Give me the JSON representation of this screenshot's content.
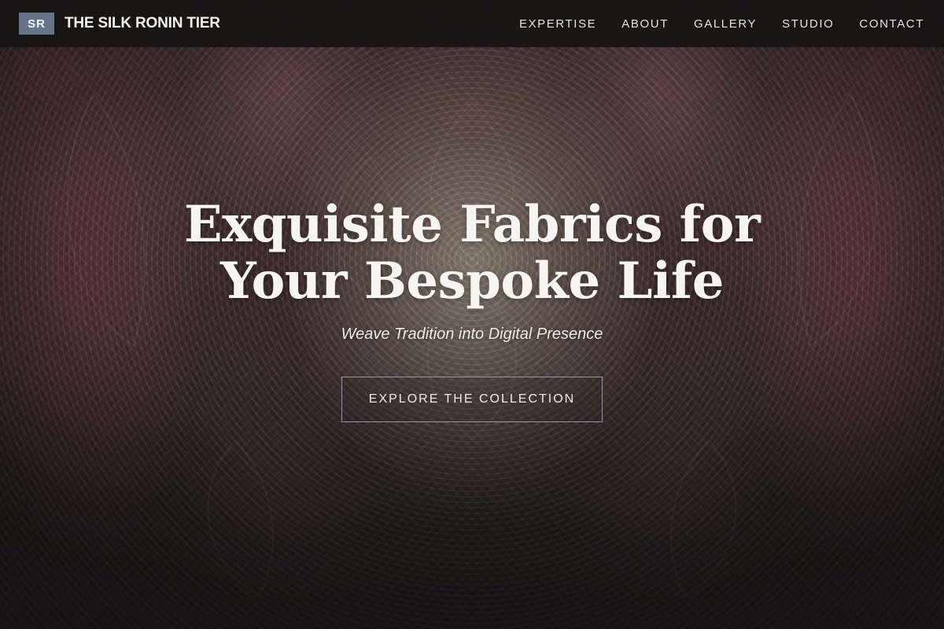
{
  "brand": {
    "logo_initials": "SR",
    "name": "THE SILK RONIN TIER"
  },
  "nav": {
    "items": [
      {
        "label": "EXPERTISE"
      },
      {
        "label": "ABOUT"
      },
      {
        "label": "GALLERY"
      },
      {
        "label": "STUDIO"
      },
      {
        "label": "CONTACT"
      }
    ]
  },
  "hero": {
    "title_line1": "Exquisite Fabrics for",
    "title_line2": "Your Bespoke Life",
    "subtitle": "Weave Tradition into Digital Presence",
    "cta_label": "EXPLORE THE COLLECTION",
    "background_image": "paisley-damask-textile"
  },
  "colors": {
    "navbar_bg": "#161414",
    "logo_badge": "#667487",
    "cta_border": "#8d98a6",
    "text_primary": "#f7f5f1"
  }
}
